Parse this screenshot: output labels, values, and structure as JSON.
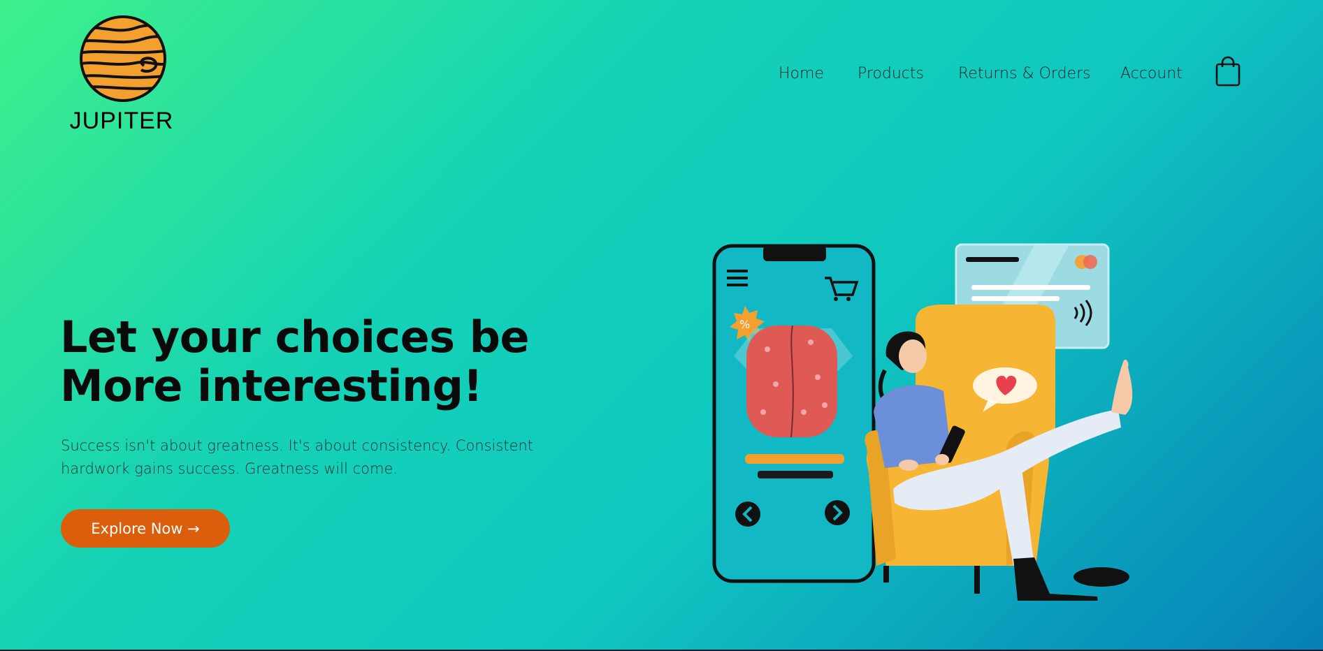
{
  "brand": {
    "name": "JUPITER",
    "icon": "jupiter-planet-logo"
  },
  "nav": {
    "items": [
      {
        "label": "Home"
      },
      {
        "label": "Products"
      },
      {
        "label": "Returns & Orders"
      },
      {
        "label": "Account"
      }
    ],
    "cart_icon": "shopping-bag-icon"
  },
  "hero": {
    "headline_line1": "Let your choices be",
    "headline_line2": "More interesting!",
    "subtext": "Success isn't about greatness. It's about consistency. Consistent hardwork gains success. Greatness will come.",
    "cta_label": "Explore Now →"
  },
  "colors": {
    "gradient_start": "#3ef08a",
    "gradient_mid": "#12cfbd",
    "gradient_end": "#0680b8",
    "cta": "#db5e0c",
    "logo_orange": "#f3a02e"
  }
}
